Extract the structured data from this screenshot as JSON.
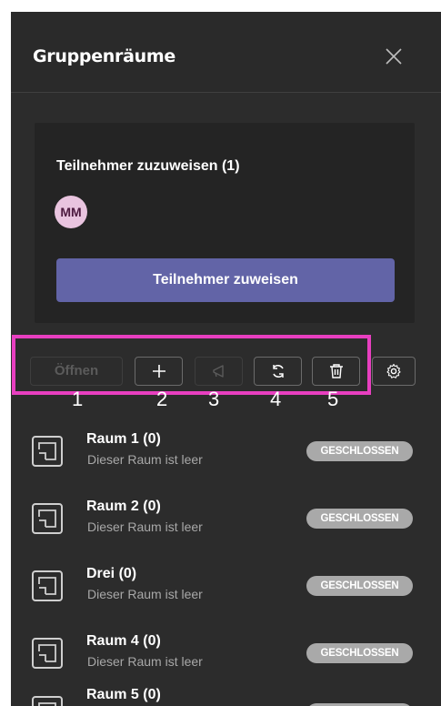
{
  "header": {
    "title": "Gruppenräume",
    "close_icon": "close-icon"
  },
  "assign_card": {
    "heading": "Teilnehmer zuzuweisen (1)",
    "avatar_initials": "MM",
    "assign_button_label": "Teilnehmer zuweisen"
  },
  "toolbar": {
    "open_label": "Öffnen",
    "add_icon": "plus-icon",
    "announce_icon": "megaphone-icon",
    "recreate_icon": "refresh-icon",
    "delete_icon": "trash-icon",
    "settings_icon": "gear-icon",
    "highlight_color": "#e83fc0"
  },
  "annotations": [
    "1",
    "2",
    "3",
    "4",
    "5"
  ],
  "rooms": [
    {
      "name": "Raum 1 (0)",
      "status": "Dieser Raum ist leer",
      "badge": "GESCHLOSSEN"
    },
    {
      "name": "Raum 2 (0)",
      "status": "Dieser Raum ist leer",
      "badge": "GESCHLOSSEN"
    },
    {
      "name": "Drei (0)",
      "status": "Dieser Raum ist leer",
      "badge": "GESCHLOSSEN"
    },
    {
      "name": "Raum 4 (0)",
      "status": "Dieser Raum ist leer",
      "badge": "GESCHLOSSEN"
    },
    {
      "name": "Raum 5 (0)",
      "status": "",
      "badge": ""
    }
  ],
  "colors": {
    "panel_bg": "#2c2c2c",
    "accent": "#6264a7",
    "badge_bg": "#a9a9a9",
    "avatar_bg": "#e9c4df"
  }
}
